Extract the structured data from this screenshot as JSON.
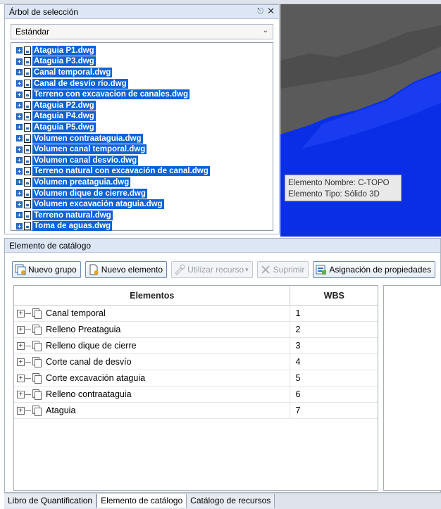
{
  "tree_panel": {
    "title": "Árbol de selección",
    "dropdown_value": "Estándar",
    "files": [
      "Ataguia P1.dwg",
      "Ataguia P3.dwg",
      "Canal temporal.dwg",
      "Canal de desvío río.dwg",
      "Terreno con excavacion de canales.dwg",
      "Ataguia P2.dwg",
      "Ataguia P4.dwg",
      "Ataguia P5.dwg",
      "Volumen contraataguia.dwg",
      "Volumen canal temporal.dwg",
      "Volumen canal desvío.dwg",
      "Terreno natural con excavación de canal.dwg",
      "Volumen preataguia.dwg",
      "Volumen dique de cierre.dwg",
      "Volumen excavación ataguia.dwg",
      "Terreno natural.dwg",
      "Toma de aguas.dwg"
    ]
  },
  "viewport": {
    "tooltip_line1": "Elemento Nombre: C-TOPO",
    "tooltip_line2": "Elemento Tipo: Sólido 3D",
    "background_color": "#5f5f5f",
    "solid_color": "#0a2ee6"
  },
  "catalog_panel": {
    "title": "Elemento de catálogo",
    "toolbar": {
      "new_group": "Nuevo grupo",
      "new_element": "Nuevo elemento",
      "use_resource": "Utilizar recurso",
      "delete": "Suprimir",
      "assign_properties": "Asignación de propiedades"
    },
    "columns": [
      "Elementos",
      "WBS"
    ],
    "rows": [
      {
        "name": "Canal temporal",
        "wbs": "1"
      },
      {
        "name": "Relleno Preataguia",
        "wbs": "2"
      },
      {
        "name": "Relleno dique de cierre",
        "wbs": "3"
      },
      {
        "name": "Corte canal de desvío",
        "wbs": "4"
      },
      {
        "name": "Corte excavación ataguia",
        "wbs": "5"
      },
      {
        "name": "Relleno contraataguia",
        "wbs": "6"
      },
      {
        "name": "Ataguia",
        "wbs": "7"
      }
    ]
  },
  "tabs": [
    "Libro de Quantification",
    "Elemento de catálogo",
    "Catálogo de recursos"
  ],
  "active_tab": 1
}
